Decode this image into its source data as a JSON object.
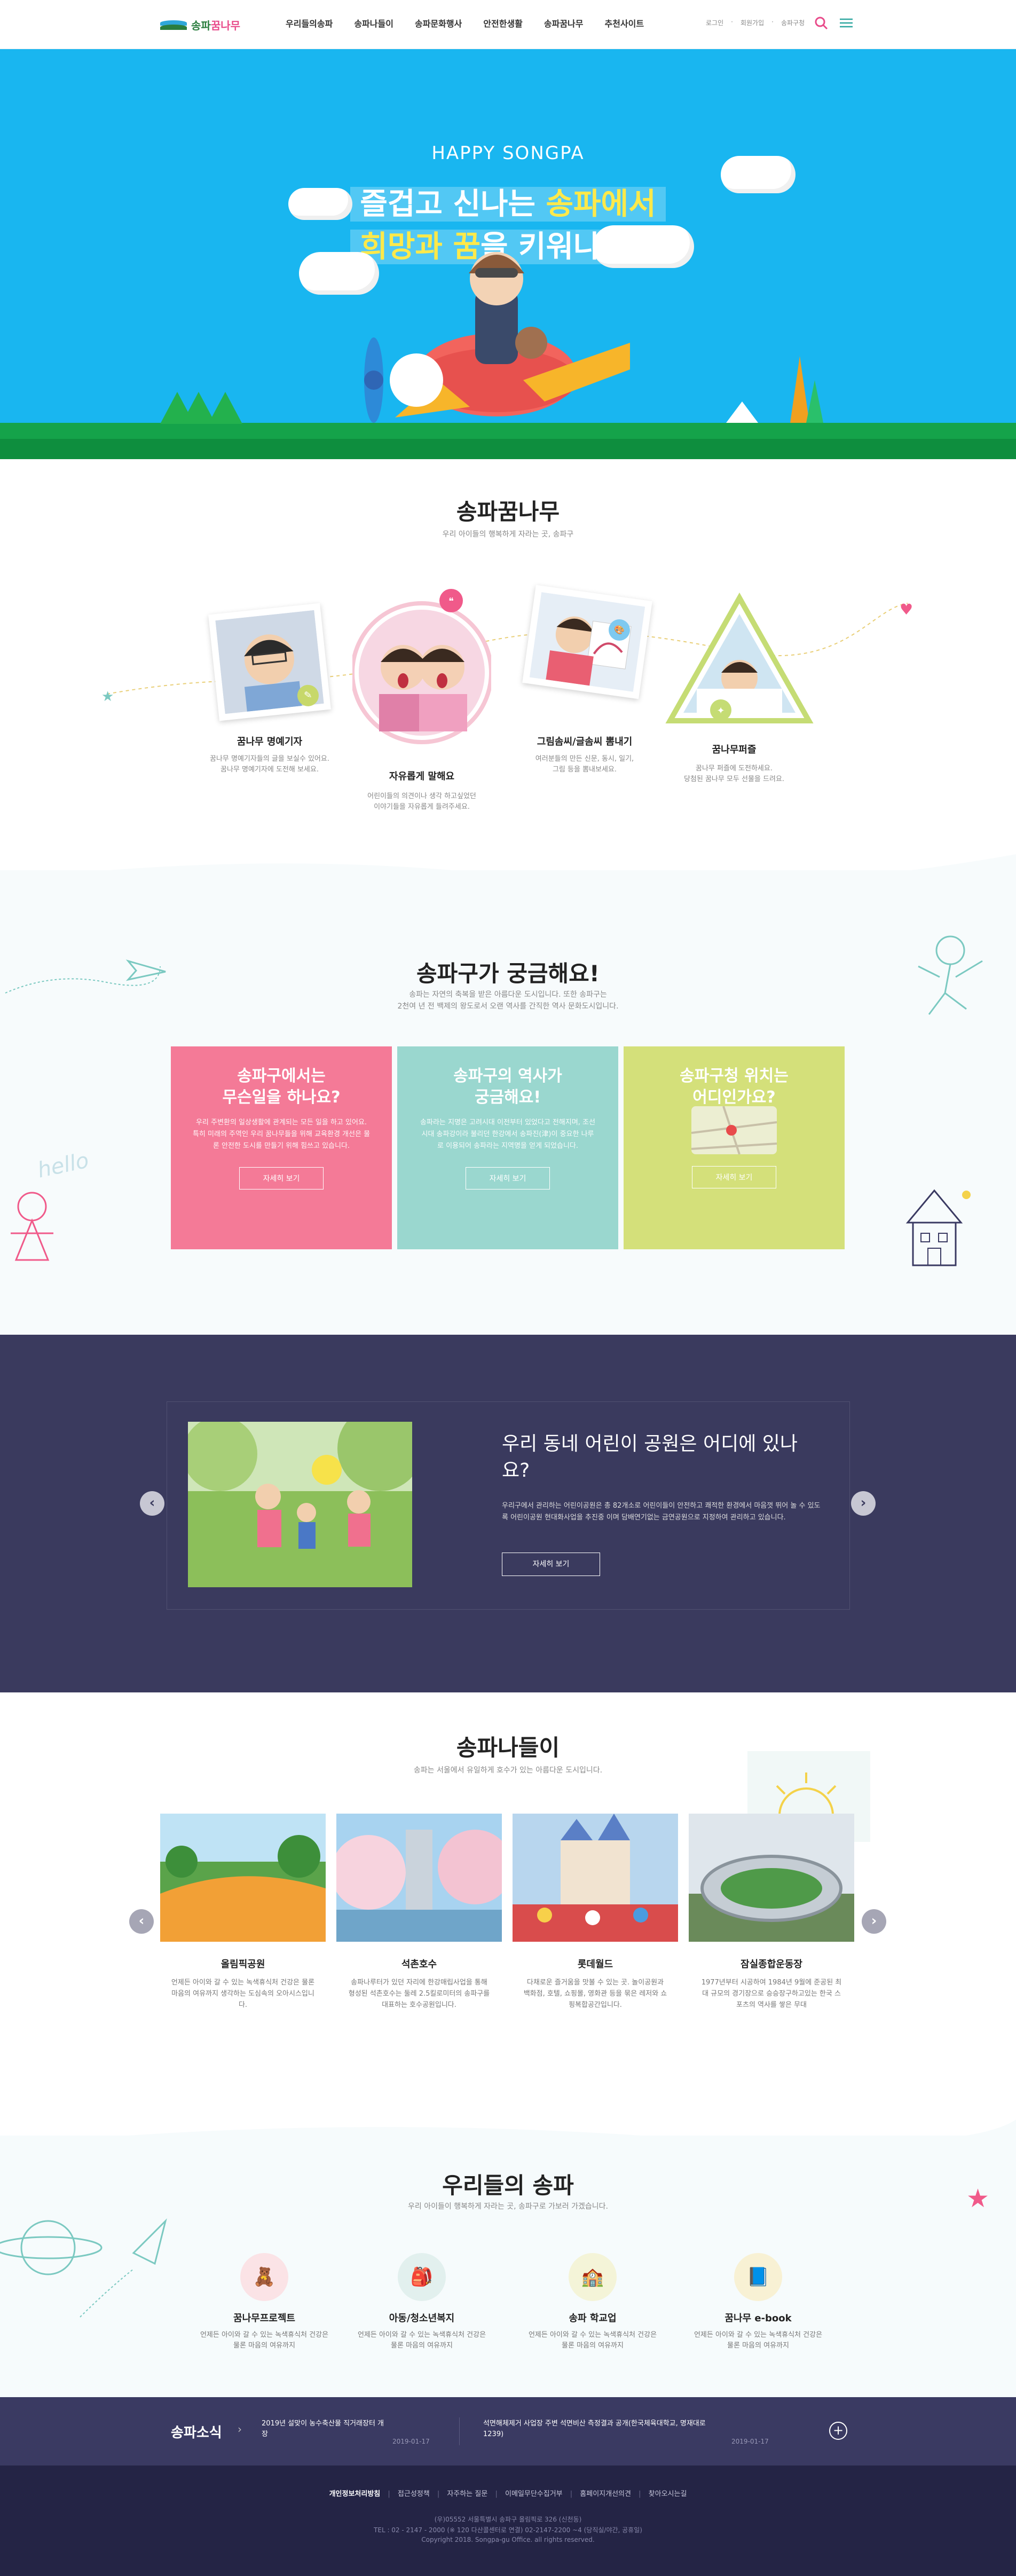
{
  "header": {
    "logo_a": "송파",
    "logo_b": "꿈나무",
    "nav": [
      "우리들의송파",
      "송파나들이",
      "송파문화행사",
      "안전한생활",
      "송파꿈나무",
      "추천사이트"
    ],
    "util": [
      "로그인",
      "회원가입",
      "송파구청"
    ],
    "brand_green": "#2a7d3e",
    "brand_pink": "#e84b8a"
  },
  "hero": {
    "sub": "HAPPY SONGPA",
    "line1_a": "즐겁고 신나는 ",
    "line1_b": "송파에서",
    "line2_a": "희망과 꿈",
    "line2_b": "을 키워나가요",
    "bg": "#19b6f0",
    "highlight": "#ffe94a"
  },
  "dream": {
    "title": "송파꿈나무",
    "desc": "우리 아이들의 행복하게 자라는 곳, 송파구",
    "cards": [
      {
        "title": "꿈나무 명예기자",
        "desc": "꿈나무 명예기자들의 글을 보실수 있어요.\n꿈나무 명예기자에 도전해 보세요."
      },
      {
        "title": "자유롭게 말해요",
        "desc": "어린이들의 의견이나 생각 하고싶었던\n이야기들을 자유롭게 들려주세요."
      },
      {
        "title": "그림솜씨/글솜씨 뽐내기",
        "desc": "여러분들의 만든 신문, 동시, 일기,\n그림 등을 뽐내보세요."
      },
      {
        "title": "꿈나무퍼즐",
        "desc": "꿈나무 퍼즐에 도전하세요.\n당첨된 꿈나무 모두 선물을 드려요."
      }
    ]
  },
  "curious": {
    "title": "송파구가 궁금해요!",
    "desc1": "송파는 자연의 축복을 받은 아름다운 도시입니다. 또한 송파구는",
    "desc2": "2천여 년 전 백제의 왕도로서 오랜 역사를 간직한 역사 문화도시입니다.",
    "hello": "hello",
    "boxes": [
      {
        "title": "송파구에서는\n무슨일을 하나요?",
        "desc": "우리 주변환의 일상생활에 관계되는 모든 일을 하고 있어요. 특히 미래의 주역인 우리 꿈나무들을 위해 교육환경 개선은 물론 안전한 도시를 만들기 위해 힘쓰고 있습니다.",
        "btn": "자세히 보기",
        "color": "#f47a97"
      },
      {
        "title": "송파구의 역사가\n궁금해요!",
        "desc": "송파라는 지명은 고려시대 이전부터 있었다고 전해지며, 조선시대 송파강이라 불리던 한강에서 송파진(津)이 중요한 나루로 이용되어 송파라는 지역명을 얻게 되었습니다.",
        "btn": "자세히 보기",
        "color": "#9ad7cf"
      },
      {
        "title": "송파구청 위치는\n어디인가요?",
        "desc": "",
        "btn": "자세히 보기",
        "color": "#d4e07a"
      }
    ]
  },
  "park": {
    "title": "우리 동네 어린이 공원은 어디에 있나요?",
    "desc": "우리구에서 관리하는 어린이공원은 총 82개소로 어린이들이 안전하고 쾌적한 환경에서 마음껏 뛰어 놀 수 있도록 어린이공원 현대화사업을 추진중 이며 담배연기없는 금연공원으로 지정하여 관리하고 있습니다.",
    "btn": "자세히 보기",
    "prev": "‹",
    "next": "›"
  },
  "nanum": {
    "title": "송파나들이",
    "desc": "송파는 서울에서 유일하게 호수가 있는 아름다운 도시입니다.",
    "places": [
      {
        "name": "올림픽공원",
        "desc": "언제든 아이와 갈 수 있는 녹색휴식처 건강은 물론 마음의 여유까지 생각하는 도심속의 오아시스입니다."
      },
      {
        "name": "석촌호수",
        "desc": "송파나루터가 있던 자리에 한강매립사업을 통해 형성된 석촌호수는 둘레 2.5킬로미터의 송파구를 대표하는 호수공원입니다."
      },
      {
        "name": "롯데월드",
        "desc": "다채로운 즐거움을 맛볼 수 있는 곳. 놀이공원과 백화점, 호텔, 쇼핑몰, 영화관 등을 묶은 레저와 쇼핑복합공간입니다."
      },
      {
        "name": "잠실종합운동장",
        "desc": "1977년부터 시공하여 1984년 9월에 준공된 최대 규모의 경기장으로 승승장구하고있는 한국 스포츠의 역사를 쌓은 무대"
      }
    ]
  },
  "our": {
    "title": "우리들의 송파",
    "desc": "우리 아이들이 행복하게 자라는 곳, 송파구로 가보러 가겠습니다.",
    "items": [
      {
        "title": "꿈나무프로젝트",
        "desc": "언제든 아이와 갈 수 있는 녹색휴식처 건강은\n물론 마음의 여유까지",
        "color": "#fbe3e6",
        "icon": "🧸"
      },
      {
        "title": "아동/청소년복지",
        "desc": "언제든 아이와 갈 수 있는 녹색휴식처 건강은\n물론 마음의 여유까지",
        "color": "#e2f0ee",
        "icon": "🎒"
      },
      {
        "title": "송파 학교업",
        "desc": "언제든 아이와 갈 수 있는 녹색휴식처 건강은\n물론 마음의 여유까지",
        "color": "#f4f4d8",
        "icon": "🏫"
      },
      {
        "title": "꿈나무 e-book",
        "desc": "언제든 아이와 갈 수 있는 녹색휴식처 건강은\n물론 마음의 여유까지",
        "color": "#f8f1d4",
        "icon": "📘"
      }
    ]
  },
  "news": {
    "label": "송파소식",
    "items": [
      {
        "title": "2019년 설맞이 농수축산물 직거래장터 개장",
        "date": "2019-01-17"
      },
      {
        "title": "석면해체제거 사업장 주변 석면비산 측정결과 공개(한국체육대학교, 명재대로 1239)",
        "date": "2019-01-17"
      }
    ],
    "more": "+"
  },
  "footer": {
    "links": [
      "개인정보처리방침",
      "접근성정책",
      "자주하는 질문",
      "이메일무단수집거부",
      "홈페이지개선의견",
      "찾아오시는길"
    ],
    "addr": "(우)05552 서울특별시 송파구 올림픽로 326 (신천동)",
    "tel": "TEL : 02 - 2147 - 2000 (※ 120 다산콜센터로 연결) 02-2147-2200 ~4 (당직실/야간, 공휴일)",
    "copy": "Copyright 2018. Songpa-gu Office. all rights reserved."
  }
}
